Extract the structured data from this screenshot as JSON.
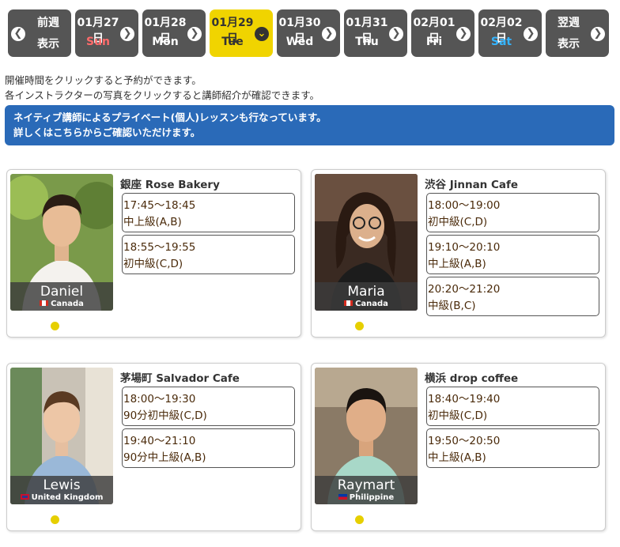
{
  "nav": {
    "prev": {
      "line1": "前週",
      "line2": "表示"
    },
    "next": {
      "line1": "翌週",
      "line2": "表示"
    },
    "days": [
      {
        "date": "01月27日",
        "weekday": "Sun"
      },
      {
        "date": "01月28日",
        "weekday": "Mon"
      },
      {
        "date": "01月29日",
        "weekday": "Tue"
      },
      {
        "date": "01月30日",
        "weekday": "Wed"
      },
      {
        "date": "01月31日",
        "weekday": "Thu"
      },
      {
        "date": "02月01日",
        "weekday": "Fri"
      },
      {
        "date": "02月02日",
        "weekday": "Sat"
      }
    ],
    "selected_index": 2
  },
  "info": {
    "line1": "開催時間をクリックすると予約ができます。",
    "line2": "各インストラクターの写真をクリックすると講師紹介が確認できます。"
  },
  "banner": {
    "line1": "ネイティブ講師によるプライベート(個人)レッスンも行なっています。",
    "line2": "詳しくはこちらからご確認いただけます。"
  },
  "instructors": [
    {
      "name": "Daniel",
      "country": "Canada",
      "venue": "銀座 Rose Bakery",
      "slots": [
        {
          "time": "17:45〜18:45",
          "level": "中上級(A,B)"
        },
        {
          "time": "18:55〜19:55",
          "level": "初中級(C,D)"
        }
      ]
    },
    {
      "name": "Maria",
      "country": "Canada",
      "venue": "渋谷 Jinnan Cafe",
      "slots": [
        {
          "time": "18:00〜19:00",
          "level": "初中級(C,D)"
        },
        {
          "time": "19:10〜20:10",
          "level": "中上級(A,B)"
        },
        {
          "time": "20:20〜21:20",
          "level": "中級(B,C)"
        }
      ]
    },
    {
      "name": "Lewis",
      "country": "United Kingdom",
      "venue": "茅場町 Salvador Cafe",
      "slots": [
        {
          "time": "18:00〜19:30",
          "level": "90分初中級(C,D)"
        },
        {
          "time": "19:40〜21:10",
          "level": "90分中上級(A,B)"
        }
      ]
    },
    {
      "name": "Raymart",
      "country": "Philippine",
      "venue": "横浜 drop coffee",
      "slots": [
        {
          "time": "18:40〜19:40",
          "level": "初中級(C,D)"
        },
        {
          "time": "19:50〜20:50",
          "level": "中上級(A,B)"
        }
      ]
    }
  ],
  "colors": {
    "nav_bg": "#555555",
    "nav_active": "#f0d400",
    "banner": "#2a6ab8",
    "sunday": "#ff6b6b",
    "saturday": "#35b4ff",
    "dot": "#e6cf00"
  }
}
